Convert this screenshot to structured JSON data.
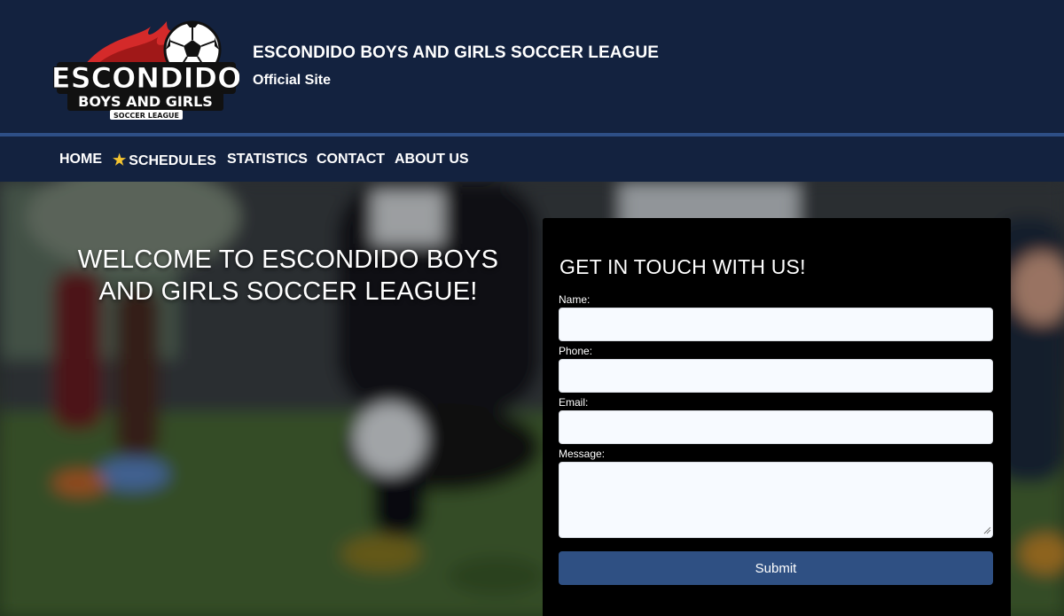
{
  "header": {
    "logo_text_main": "ESCONDIDO",
    "logo_text_sub": "BOYS AND GIRLS",
    "logo_text_small": "SOCCER LEAGUE",
    "title": "ESCONDIDO BOYS AND GIRLS SOCCER LEAGUE",
    "subtitle": "Official Site"
  },
  "nav": {
    "items": [
      {
        "label": "HOME"
      },
      {
        "label": "SCHEDULES",
        "icon": "star-icon"
      },
      {
        "label": "STATISTICS"
      },
      {
        "label": "CONTACT"
      },
      {
        "label": "ABOUT US"
      }
    ]
  },
  "hero": {
    "title": "WELCOME TO ESCONDIDO BOYS AND GIRLS SOCCER LEAGUE!"
  },
  "contact": {
    "title": "GET IN TOUCH WITH US!",
    "name_label": "Name:",
    "name_value": "",
    "phone_label": "Phone:",
    "phone_value": "",
    "email_label": "Email:",
    "email_value": "",
    "message_label": "Message:",
    "message_value": "",
    "submit_label": "Submit"
  },
  "colors": {
    "header_bg": "#13223f",
    "accent": "#2e4f86",
    "button": "#2f5083",
    "star": "#f4c430",
    "logo_red": "#d42a2a"
  }
}
